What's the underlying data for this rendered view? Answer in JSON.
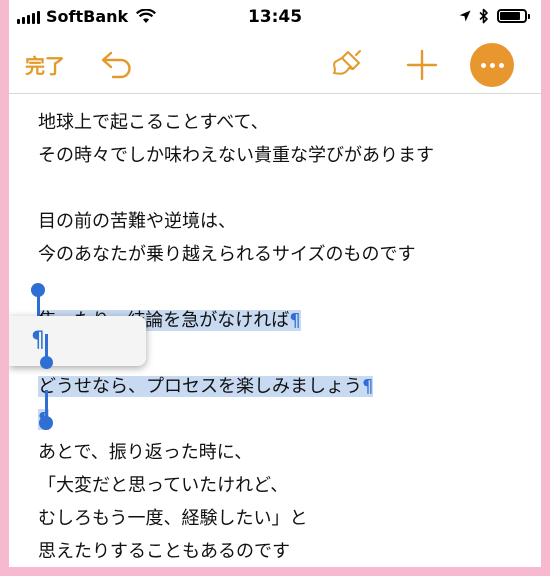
{
  "status_bar": {
    "carrier": "SoftBank",
    "time": "13:45",
    "battery_level": 0.9
  },
  "toolbar": {
    "done_label": "完了",
    "icons": [
      "undo-icon",
      "paintbrush-icon",
      "plus-icon",
      "more-icon"
    ],
    "accent_color": "#e8972e"
  },
  "document": {
    "lines": [
      "地球上で起こることすべて、",
      "その時々でしか味わえない貴重な学びがあります",
      "",
      "目の前の苦難や逆境は、",
      "今のあなたが乗り越えられるサイズのものです",
      "",
      "焦ったり、結論を急がなければ",
      "",
      "どうせなら、プロセスを楽しみましょう",
      "",
      "あとで、振り返った時に、",
      "「大変だと思っていたけれど、",
      "むしろもう一度、経験したい」と",
      "思えたりすることもあるのです"
    ],
    "pilcrow": "¶",
    "selection_color": "#c8daf1"
  }
}
